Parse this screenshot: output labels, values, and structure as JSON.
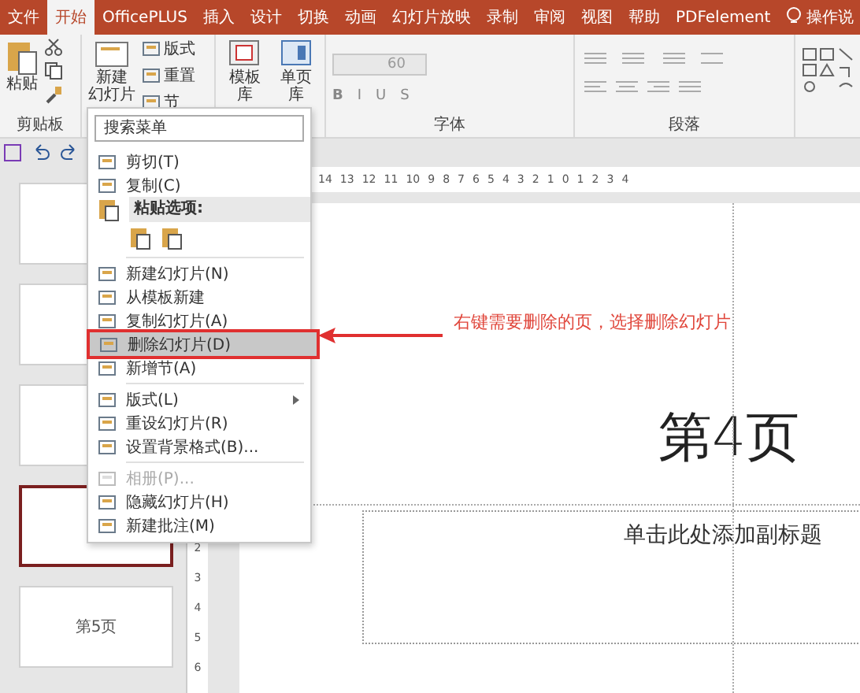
{
  "tabs": [
    {
      "label": "文件",
      "selected": false
    },
    {
      "label": "开始",
      "selected": true
    },
    {
      "label": "OfficePLUS",
      "selected": false
    },
    {
      "label": "插入",
      "selected": false
    },
    {
      "label": "设计",
      "selected": false
    },
    {
      "label": "切换",
      "selected": false
    },
    {
      "label": "动画",
      "selected": false
    },
    {
      "label": "幻灯片放映",
      "selected": false
    },
    {
      "label": "录制",
      "selected": false
    },
    {
      "label": "审阅",
      "selected": false
    },
    {
      "label": "视图",
      "selected": false
    },
    {
      "label": "帮助",
      "selected": false
    },
    {
      "label": "PDFelement",
      "selected": false
    }
  ],
  "tell_me": "操作说",
  "ribbon": {
    "paste": "粘贴",
    "clipboard_label": "剪贴板",
    "new_slide": [
      "新建",
      "幻灯片"
    ],
    "layout": "版式",
    "reset": "重置",
    "section": "节",
    "template_library": "模板库",
    "page_library": "单页库",
    "font_size": "60",
    "format_buttons": [
      "B",
      "I",
      "U",
      "S"
    ],
    "font_label": "字体",
    "paragraph_label": "段落"
  },
  "slide_panel": {
    "thumbnails": [
      {
        "selected": false
      },
      {
        "selected": false
      },
      {
        "selected": false
      },
      {
        "selected": true
      },
      {
        "selected": false,
        "caption": "第5页"
      }
    ]
  },
  "ruler": {
    "horizontal": [
      "14",
      "13",
      "12",
      "11",
      "10",
      "9",
      "8",
      "7",
      "6",
      "5",
      "4",
      "3",
      "2",
      "1",
      "0",
      "1",
      "2",
      "3",
      "4"
    ],
    "vertical": [
      "2",
      "3",
      "4",
      "5",
      "6"
    ]
  },
  "slide": {
    "title": "第4页",
    "subtitle_placeholder": "单击此处添加副标题"
  },
  "annotation": "右键需要删除的页，选择删除幻灯片",
  "context_menu": {
    "search_placeholder": "搜索菜单",
    "items": [
      {
        "kind": "item",
        "label": "剪切(T)",
        "selected": false,
        "disabled": false
      },
      {
        "kind": "item",
        "label": "复制(C)",
        "selected": false,
        "disabled": false
      },
      {
        "kind": "header",
        "label": "粘贴选项:"
      },
      {
        "kind": "paste_options"
      },
      {
        "kind": "separator"
      },
      {
        "kind": "item",
        "label": "新建幻灯片(N)",
        "selected": false,
        "disabled": false
      },
      {
        "kind": "item",
        "label": "从模板新建",
        "selected": false,
        "disabled": false
      },
      {
        "kind": "item",
        "label": "复制幻灯片(A)",
        "selected": false,
        "disabled": false
      },
      {
        "kind": "item",
        "label": "删除幻灯片(D)",
        "selected": true,
        "disabled": false
      },
      {
        "kind": "item",
        "label": "新增节(A)",
        "selected": false,
        "disabled": false
      },
      {
        "kind": "separator"
      },
      {
        "kind": "item",
        "label": "版式(L)",
        "selected": false,
        "disabled": false,
        "has_submenu": true
      },
      {
        "kind": "item",
        "label": "重设幻灯片(R)",
        "selected": false,
        "disabled": false
      },
      {
        "kind": "item",
        "label": "设置背景格式(B)...",
        "selected": false,
        "disabled": false
      },
      {
        "kind": "separator"
      },
      {
        "kind": "item",
        "label": "相册(P)...",
        "selected": false,
        "disabled": true
      },
      {
        "kind": "item",
        "label": "隐藏幻灯片(H)",
        "selected": false,
        "disabled": false
      },
      {
        "kind": "item",
        "label": "新建批注(M)",
        "selected": false,
        "disabled": false
      }
    ]
  }
}
